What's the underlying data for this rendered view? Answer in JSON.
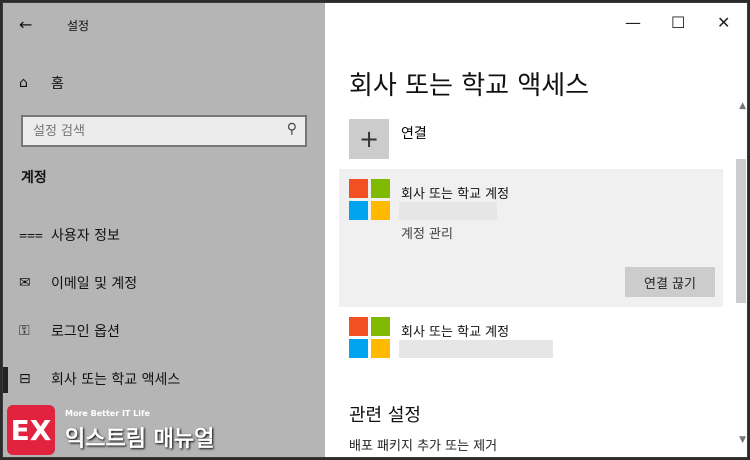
{
  "app": {
    "title": "설정",
    "back_glyph": "←"
  },
  "sidebar": {
    "home": {
      "label": "홈",
      "icon": "home-icon",
      "glyph": "⌂"
    },
    "search": {
      "placeholder": "설정 검색",
      "icon": "search-icon",
      "glyph": "⚲"
    },
    "section_title": "계정",
    "items": [
      {
        "label": "사용자 정보",
        "icon": "person-info-icon",
        "glyph": "⩶"
      },
      {
        "label": "이메일 및 계정",
        "icon": "mail-icon",
        "glyph": "✉"
      },
      {
        "label": "로그인 옵션",
        "icon": "key-icon",
        "glyph": "⚿"
      },
      {
        "label": "회사 또는 학교 액세스",
        "icon": "briefcase-icon",
        "glyph": "⊟"
      }
    ]
  },
  "window_controls": {
    "minimize": "—",
    "maximize": "☐",
    "close": "✕"
  },
  "main": {
    "title": "회사 또는 학교 액세스",
    "connect": {
      "glyph": "+",
      "label": "연결"
    },
    "accounts": [
      {
        "title": "회사 또는 학교 계정",
        "manage_label": "계정 관리",
        "disconnect_label": "연결 끊기"
      },
      {
        "title": "회사 또는 학교 계정"
      }
    ],
    "related": {
      "title": "관련 설정",
      "link": "배포 패키지 추가 또는 제거"
    }
  },
  "ms_logo_colors": [
    "#f25022",
    "#7fba00",
    "#00a4ef",
    "#ffb900"
  ],
  "watermark": {
    "logo_text": "EX",
    "tagline": "More Better IT Life",
    "name": "익스트림 매뉴얼"
  }
}
